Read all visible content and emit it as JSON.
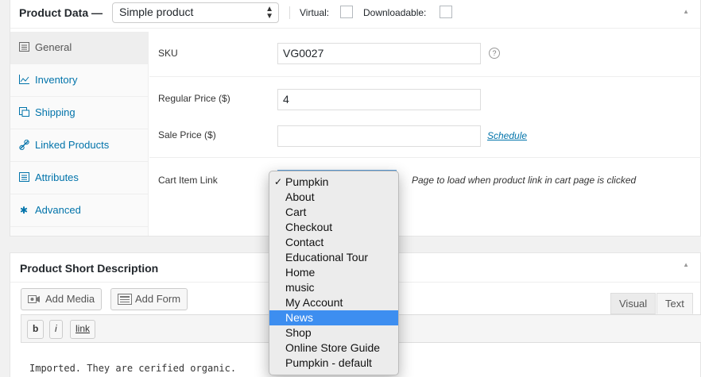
{
  "product_data": {
    "title": "Product Data —",
    "type_value": "Simple product",
    "virtual_label": "Virtual:",
    "downloadable_label": "Downloadable:",
    "tabs": [
      {
        "label": "General",
        "icon": "general-icon"
      },
      {
        "label": "Inventory",
        "icon": "inventory-icon"
      },
      {
        "label": "Shipping",
        "icon": "shipping-icon"
      },
      {
        "label": "Linked Products",
        "icon": "link-icon"
      },
      {
        "label": "Attributes",
        "icon": "attributes-icon"
      },
      {
        "label": "Advanced",
        "icon": "gear-icon"
      }
    ],
    "sku_label": "SKU",
    "sku_value": "VG0027",
    "regular_price_label": "Regular Price ($)",
    "regular_price_value": "4",
    "sale_price_label": "Sale Price ($)",
    "sale_price_value": "",
    "schedule_label": "Schedule",
    "cart_item_link_label": "Cart Item Link",
    "cart_item_link_hint": "Page to load when product link in cart page is clicked"
  },
  "dropdown": {
    "selected": "Pumpkin",
    "highlighted": "News",
    "options": [
      "Pumpkin",
      "About",
      "Cart",
      "Checkout",
      "Contact",
      "Educational Tour",
      "Home",
      "music",
      "My Account",
      "News",
      "Shop",
      "Online Store Guide",
      "Pumpkin - default"
    ]
  },
  "short_description": {
    "title": "Product Short Description",
    "add_media_label": "Add Media",
    "add_form_label": "Add Form",
    "visual_tab": "Visual",
    "text_tab": "Text",
    "quicktags": [
      "b",
      "i",
      "link"
    ],
    "content": "Imported. They are cerified organic."
  },
  "colors": {
    "link": "#0073aa",
    "highlight": "#3d8ef0"
  }
}
